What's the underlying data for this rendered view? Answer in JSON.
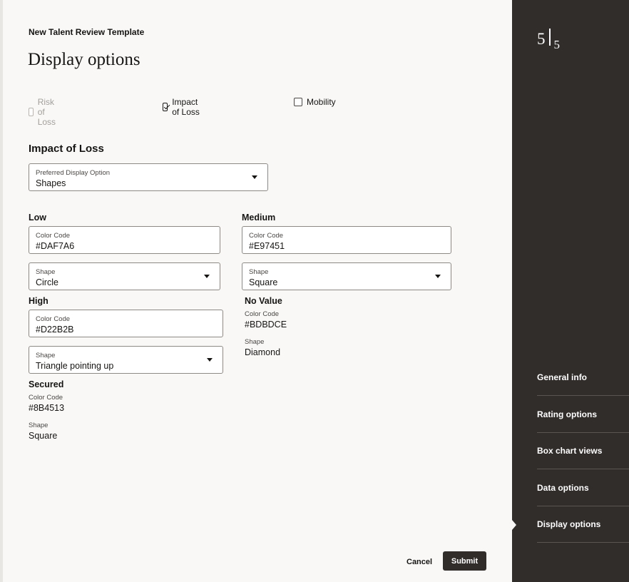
{
  "header": {
    "breadcrumb": "New Talent Review Template",
    "title": "Display options"
  },
  "options": {
    "risk_of_loss": "Risk of Loss",
    "impact_of_loss": "Impact of Loss",
    "mobility": "Mobility"
  },
  "section": {
    "title": "Impact of Loss",
    "preferred_label": "Preferred Display Option",
    "preferred_value": "Shapes"
  },
  "levels": {
    "low": {
      "title": "Low",
      "color_label": "Color Code",
      "color": "#DAF7A6",
      "shape_label": "Shape",
      "shape": "Circle"
    },
    "medium": {
      "title": "Medium",
      "color_label": "Color Code",
      "color": "#E97451",
      "shape_label": "Shape",
      "shape": "Square"
    },
    "high": {
      "title": "High",
      "color_label": "Color Code",
      "color": "#D22B2B",
      "shape_label": "Shape",
      "shape": "Triangle pointing up"
    },
    "no_value": {
      "title": "No Value",
      "color_label": "Color Code",
      "color": "#BDBDCE",
      "shape_label": "Shape",
      "shape": "Diamond"
    },
    "secured": {
      "title": "Secured",
      "color_label": "Color Code",
      "color": "#8B4513",
      "shape_label": "Shape",
      "shape": "Square"
    }
  },
  "footer": {
    "cancel": "Cancel",
    "submit": "Submit"
  },
  "sidebar": {
    "step_current": "5",
    "step_total": "5",
    "items": [
      {
        "label": "General info"
      },
      {
        "label": "Rating options"
      },
      {
        "label": "Box chart views"
      },
      {
        "label": "Data options"
      },
      {
        "label": "Display options"
      }
    ]
  }
}
